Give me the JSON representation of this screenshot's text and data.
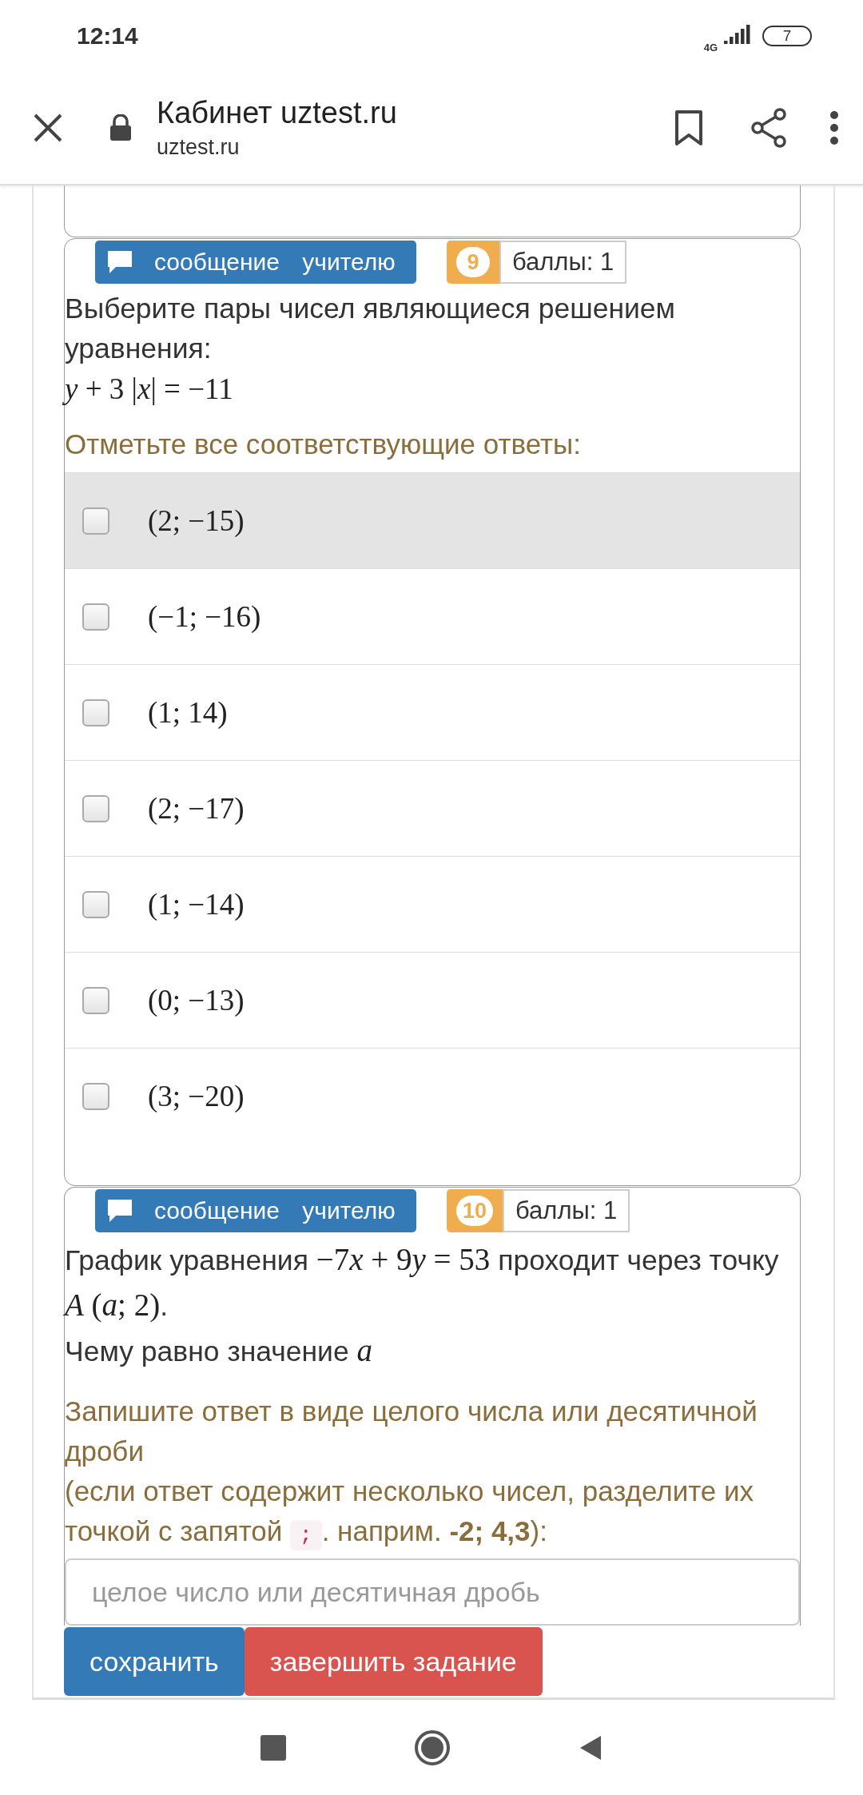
{
  "status_bar": {
    "time": "12:14",
    "network": "4G",
    "battery": "7"
  },
  "browser_bar": {
    "title": "Кабинет uztest.ru",
    "url": "uztest.ru"
  },
  "questions": [
    {
      "kind": "choice",
      "message_button": "сообщение учителю",
      "number": "9",
      "points": "баллы: 1",
      "text": "Выберите пары чисел являющиеся решением уравнения:",
      "equation": "*y* + 3 |*x*| = −11",
      "instruction": "Отметьте все соответствующие ответы:",
      "options": [
        {
          "label": "(2; −15)",
          "checked": false,
          "highlighted": true
        },
        {
          "label": "(−1; −16)",
          "checked": false,
          "highlighted": false
        },
        {
          "label": "(1; 14)",
          "checked": false,
          "highlighted": false
        },
        {
          "label": "(2; −17)",
          "checked": false,
          "highlighted": false
        },
        {
          "label": "(1; −14)",
          "checked": false,
          "highlighted": false
        },
        {
          "label": "(0; −13)",
          "checked": false,
          "highlighted": false
        },
        {
          "label": "(3; −20)",
          "checked": false,
          "highlighted": false
        }
      ]
    },
    {
      "kind": "input",
      "message_button": "сообщение учителю",
      "number": "10",
      "points": "баллы: 1",
      "lines": [
        [
          {
            "kind": "text",
            "text": "График уравнения "
          },
          {
            "kind": "math",
            "text": "−7"
          },
          {
            "kind": "math",
            "text": "*x*"
          },
          {
            "kind": "math",
            "text": " + 9"
          },
          {
            "kind": "math",
            "text": "*y*"
          },
          {
            "kind": "math",
            "text": " = 53"
          },
          {
            "kind": "text",
            "text": " проходит через точку "
          },
          {
            "kind": "math",
            "text": "*A* (*a*; 2)"
          },
          {
            "kind": "text",
            "text": "."
          }
        ],
        [
          {
            "kind": "text",
            "text": "Чему равно значение "
          },
          {
            "kind": "math",
            "text": "*a*"
          }
        ]
      ],
      "instruction": [
        [
          {
            "kind": "text",
            "text": "Запишите ответ в виде целого числа или десятичной дроби"
          }
        ],
        [
          {
            "kind": "text",
            "text": "(если ответ содержит несколько чисел, разделите их точкой с запятой "
          },
          {
            "kind": "code",
            "text": ";"
          },
          {
            "kind": "text",
            "text": ". наприм. **-2; 4,3**):"
          }
        ]
      ],
      "placeholder": "целое число или десятичная дробь"
    }
  ],
  "buttons": [
    {
      "label": "сохранить",
      "kind": "primary"
    },
    {
      "label": "завершить задание",
      "kind": "danger"
    }
  ]
}
